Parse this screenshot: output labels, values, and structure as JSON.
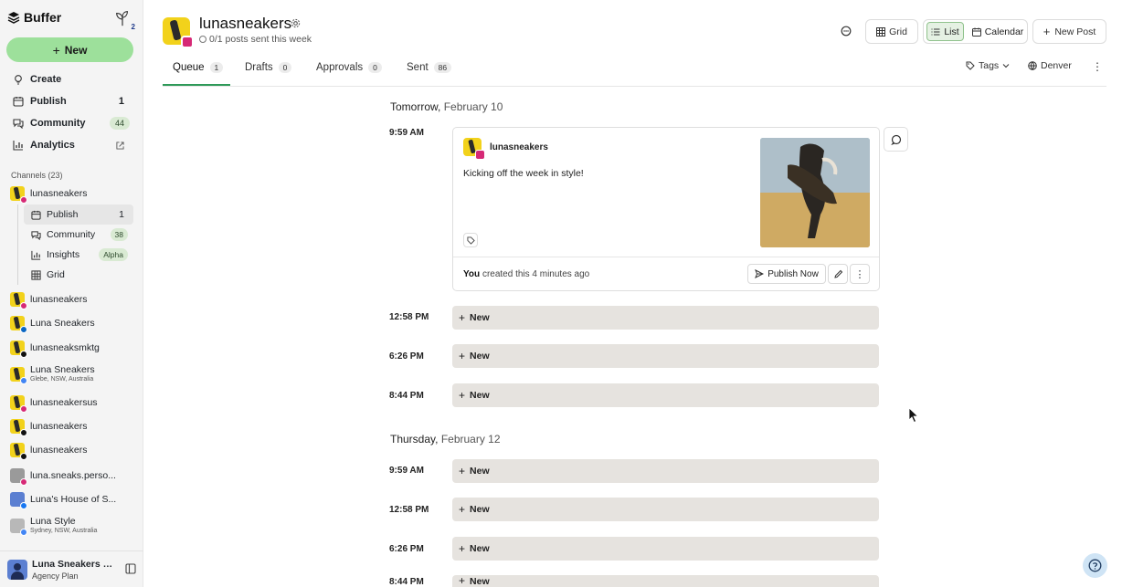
{
  "app": {
    "name": "Buffer",
    "notification_count": "2"
  },
  "sidebar": {
    "new_label": "New",
    "nav": [
      {
        "label": "Create",
        "icon": "lightbulb-icon"
      },
      {
        "label": "Publish",
        "count": "1",
        "icon": "calendar-icon"
      },
      {
        "label": "Community",
        "count": "44",
        "icon": "chat-bubbles-icon"
      },
      {
        "label": "Analytics",
        "icon": "bar-chart-icon"
      }
    ],
    "channels_label": "Channels (23)",
    "channels": [
      {
        "name": "lunasneakers",
        "network": "instagram",
        "color": "#d62976"
      },
      {
        "name": "lunasneakers",
        "network": "instagram",
        "color": "#d62976"
      },
      {
        "name": "Luna Sneakers",
        "network": "linkedin",
        "color": "#0a66c2"
      },
      {
        "name": "lunasneaksmktg",
        "network": "x",
        "color": "#111111"
      },
      {
        "name": "Luna Sneakers",
        "sub": "Glebe, NSW, Australia",
        "network": "google-business",
        "color": "#4285f4"
      },
      {
        "name": "lunasneakersus",
        "network": "instagram",
        "color": "#d62976"
      },
      {
        "name": "lunasneakers",
        "network": "tiktok",
        "color": "#111111"
      },
      {
        "name": "lunasneakers",
        "network": "threads",
        "color": "#111111"
      },
      {
        "name": "luna.sneaks.perso...",
        "network": "instagram",
        "color": "#d62976"
      },
      {
        "name": "Luna's House of S...",
        "network": "facebook",
        "color": "#1877f2"
      },
      {
        "name": "Luna Style",
        "sub": "Sydney, NSW, Australia",
        "network": "google-business",
        "color": "#4285f4"
      }
    ],
    "channel_sub_nav": [
      {
        "label": "Publish",
        "count": "1",
        "icon": "calendar-icon"
      },
      {
        "label": "Community",
        "count": "38",
        "icon": "chat-bubbles-icon"
      },
      {
        "label": "Insights",
        "badge": "Alpha",
        "icon": "bar-chart-icon"
      },
      {
        "label": "Grid",
        "icon": "grid-icon"
      }
    ],
    "account": {
      "name": "Luna Sneakers Te...",
      "plan": "Agency Plan"
    }
  },
  "header": {
    "channel_name": "lunasneakers",
    "status": "0/1 posts sent this week",
    "views": {
      "grid": "Grid",
      "list": "List",
      "calendar": "Calendar"
    },
    "active_view": "List",
    "new_post": "New Post"
  },
  "tabs": [
    {
      "label": "Queue",
      "count": "1"
    },
    {
      "label": "Drafts",
      "count": "0"
    },
    {
      "label": "Approvals",
      "count": "0"
    },
    {
      "label": "Sent",
      "count": "86"
    }
  ],
  "filters": {
    "tags": "Tags",
    "timezone": "Denver"
  },
  "queue": {
    "days": [
      {
        "label": "Tomorrow,",
        "date": "February 10"
      },
      {
        "label": "Thursday,",
        "date": "February 12"
      }
    ],
    "post": {
      "time": "9:59 AM",
      "channel": "lunasneakers",
      "text": "Kicking off the week in style!",
      "created_by": "You",
      "created_rest": "created this 4 minutes ago",
      "publish_now": "Publish Now"
    },
    "slots_day1": [
      {
        "time": "12:58 PM",
        "label": "New"
      },
      {
        "time": "6:26 PM",
        "label": "New"
      },
      {
        "time": "8:44 PM",
        "label": "New"
      }
    ],
    "slots_day2": [
      {
        "time": "9:59 AM",
        "label": "New"
      },
      {
        "time": "12:58 PM",
        "label": "New"
      },
      {
        "time": "6:26 PM",
        "label": "New"
      },
      {
        "time": "8:44 PM",
        "label": "New"
      }
    ]
  },
  "colors": {
    "accent_green": "#9de09b",
    "tab_underline": "#2f9a59",
    "slot_bg": "#e6e3df"
  }
}
